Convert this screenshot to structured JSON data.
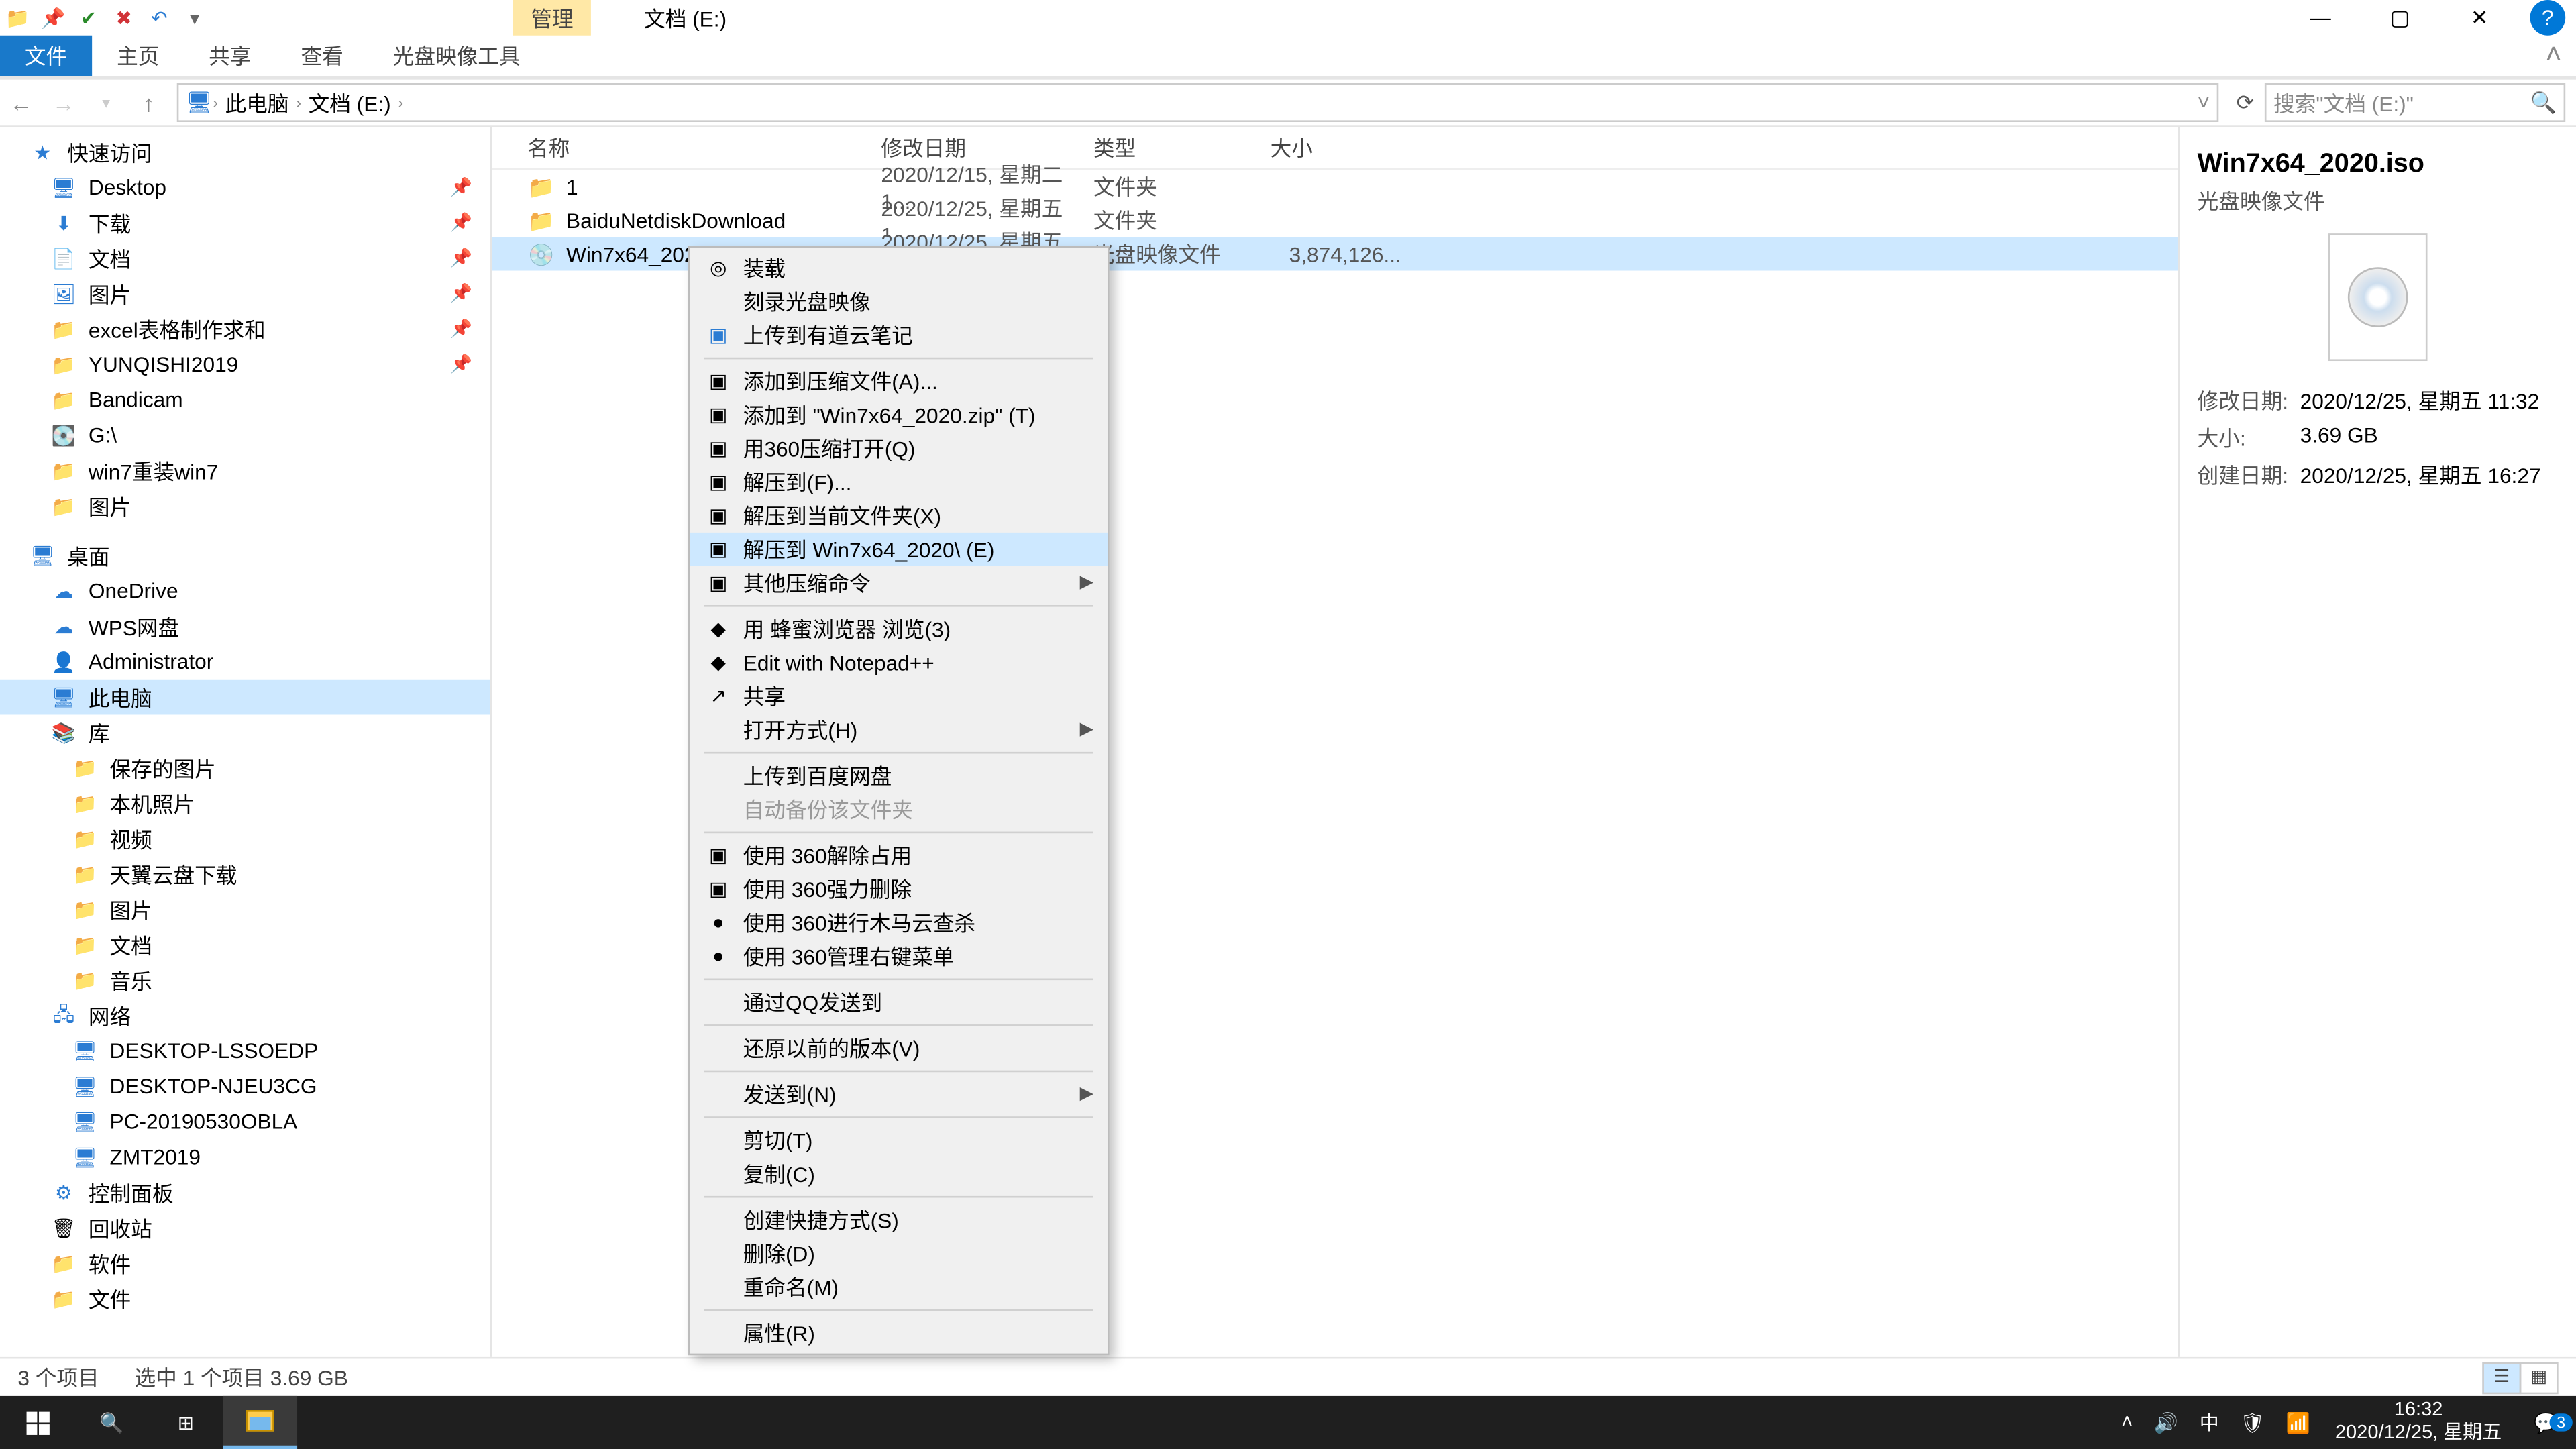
{
  "title": "文档 (E:)",
  "contextTab": "管理",
  "ribbon": {
    "file": "文件",
    "home": "主页",
    "share": "共享",
    "view": "查看",
    "tool": "光盘映像工具"
  },
  "breadcrumbs": [
    "此电脑",
    "文档 (E:)"
  ],
  "searchPlaceholder": "搜索\"文档 (E:)\"",
  "tree": {
    "quick": "快速访问",
    "quickItems": [
      "Desktop",
      "下载",
      "文档",
      "图片",
      "excel表格制作求和",
      "YUNQISHI2019",
      "Bandicam",
      "G:\\",
      "win7重装win7",
      "图片"
    ],
    "desktop": "桌面",
    "desktopItems": [
      "OneDrive",
      "WPS网盘",
      "Administrator",
      "此电脑",
      "库"
    ],
    "libItems": [
      "保存的图片",
      "本机照片",
      "视频",
      "天翼云盘下载",
      "图片",
      "文档",
      "音乐"
    ],
    "network": "网络",
    "netItems": [
      "DESKTOP-LSSOEDP",
      "DESKTOP-NJEU3CG",
      "PC-20190530OBLA",
      "ZMT2019"
    ],
    "extra": [
      "控制面板",
      "回收站",
      "软件",
      "文件"
    ]
  },
  "cols": {
    "name": "名称",
    "date": "修改日期",
    "type": "类型",
    "size": "大小"
  },
  "rows": [
    {
      "name": "1",
      "date": "2020/12/15, 星期二 1...",
      "type": "文件夹",
      "size": ""
    },
    {
      "name": "BaiduNetdiskDownload",
      "date": "2020/12/25, 星期五 1...",
      "type": "文件夹",
      "size": ""
    },
    {
      "name": "Win7x64_2020.iso",
      "date": "2020/12/25, 星期五 1...",
      "type": "光盘映像文件",
      "size": "3,874,126..."
    }
  ],
  "details": {
    "title": "Win7x64_2020.iso",
    "sub": "光盘映像文件",
    "mtimeK": "修改日期:",
    "mtimeV": "2020/12/25, 星期五 11:32",
    "sizeK": "大小:",
    "sizeV": "3.69 GB",
    "ctimeK": "创建日期:",
    "ctimeV": "2020/12/25, 星期五 16:27"
  },
  "status": {
    "count": "3 个项目",
    "sel": "选中 1 个项目  3.69 GB"
  },
  "ctx": [
    {
      "t": "i",
      "icon": "◎",
      "label": "装载"
    },
    {
      "t": "i",
      "icon": "",
      "label": "刻录光盘映像"
    },
    {
      "t": "i",
      "icon": "▣",
      "label": "上传到有道云笔记",
      "blue": true
    },
    {
      "t": "hr"
    },
    {
      "t": "i",
      "icon": "▣",
      "label": "添加到压缩文件(A)..."
    },
    {
      "t": "i",
      "icon": "▣",
      "label": "添加到 \"Win7x64_2020.zip\" (T)"
    },
    {
      "t": "i",
      "icon": "▣",
      "label": "用360压缩打开(Q)"
    },
    {
      "t": "i",
      "icon": "▣",
      "label": "解压到(F)..."
    },
    {
      "t": "i",
      "icon": "▣",
      "label": "解压到当前文件夹(X)"
    },
    {
      "t": "i",
      "icon": "▣",
      "label": "解压到 Win7x64_2020\\ (E)",
      "hl": true
    },
    {
      "t": "i",
      "icon": "▣",
      "label": "其他压缩命令",
      "sub": true
    },
    {
      "t": "hr"
    },
    {
      "t": "i",
      "icon": "◆",
      "label": "用 蜂蜜浏览器 浏览(3)"
    },
    {
      "t": "i",
      "icon": "◆",
      "label": "Edit with Notepad++"
    },
    {
      "t": "i",
      "icon": "↗",
      "label": "共享"
    },
    {
      "t": "i",
      "icon": "",
      "label": "打开方式(H)",
      "sub": true
    },
    {
      "t": "hr"
    },
    {
      "t": "i",
      "icon": "",
      "label": "上传到百度网盘"
    },
    {
      "t": "i",
      "icon": "",
      "label": "自动备份该文件夹",
      "disabled": true
    },
    {
      "t": "hr"
    },
    {
      "t": "i",
      "icon": "▣",
      "label": "使用 360解除占用"
    },
    {
      "t": "i",
      "icon": "▣",
      "label": "使用 360强力删除"
    },
    {
      "t": "i",
      "icon": "●",
      "label": "使用 360进行木马云查杀"
    },
    {
      "t": "i",
      "icon": "●",
      "label": "使用 360管理右键菜单"
    },
    {
      "t": "hr"
    },
    {
      "t": "i",
      "icon": "",
      "label": "通过QQ发送到"
    },
    {
      "t": "hr"
    },
    {
      "t": "i",
      "icon": "",
      "label": "还原以前的版本(V)"
    },
    {
      "t": "hr"
    },
    {
      "t": "i",
      "icon": "",
      "label": "发送到(N)",
      "sub": true
    },
    {
      "t": "hr"
    },
    {
      "t": "i",
      "icon": "",
      "label": "剪切(T)"
    },
    {
      "t": "i",
      "icon": "",
      "label": "复制(C)"
    },
    {
      "t": "hr"
    },
    {
      "t": "i",
      "icon": "",
      "label": "创建快捷方式(S)"
    },
    {
      "t": "i",
      "icon": "",
      "label": "删除(D)"
    },
    {
      "t": "i",
      "icon": "",
      "label": "重命名(M)"
    },
    {
      "t": "hr"
    },
    {
      "t": "i",
      "icon": "",
      "label": "属性(R)"
    }
  ],
  "taskbar": {
    "time": "16:32",
    "date": "2020/12/25, 星期五",
    "ime": "中",
    "badge": "3"
  }
}
